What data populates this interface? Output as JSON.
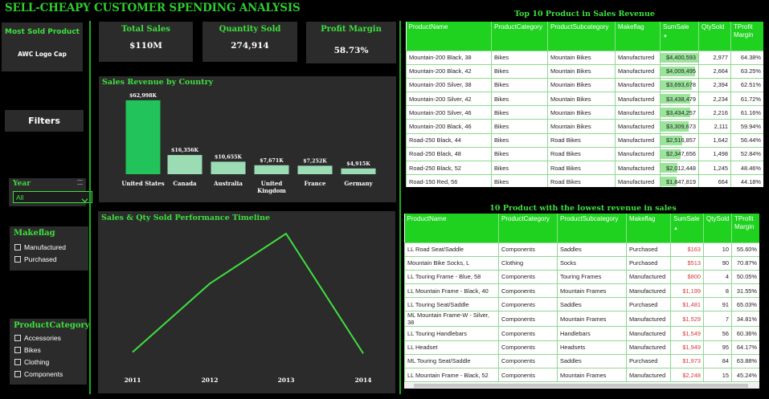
{
  "title": "SELL-CHEAPY CUSTOMER SPENDING ANALYSIS",
  "most_sold": {
    "label": "Most Sold Product",
    "value": "AWC Logo Cap"
  },
  "filters_label": "Filters",
  "kpis": [
    {
      "label": "Total Sales",
      "value": "$110M"
    },
    {
      "label": "Quantity Sold",
      "value": "274,914"
    },
    {
      "label": "Profit Margin",
      "value": "58.73%"
    }
  ],
  "year_slicer": {
    "title": "Year",
    "selected": "All"
  },
  "makeflag_slicer": {
    "title": "Makeflag",
    "options": [
      "Manufactured",
      "Purchased"
    ]
  },
  "category_slicer": {
    "title": "ProductCategory",
    "options": [
      "Accessories",
      "Bikes",
      "Clothing",
      "Components"
    ]
  },
  "chart_data": [
    {
      "type": "bar",
      "title": "Sales Revenue by Country",
      "categories": [
        "United States",
        "Canada",
        "Australia",
        "United Kingdom",
        "France",
        "Germany"
      ],
      "category_lines": [
        [
          "United States"
        ],
        [
          "Canada"
        ],
        [
          "Australia"
        ],
        [
          "United",
          "Kingdom"
        ],
        [
          "France"
        ],
        [
          "Germany"
        ]
      ],
      "values": [
        62998,
        16356,
        10655,
        7671,
        7252,
        4915
      ],
      "data_labels": [
        "$62,998K",
        "$16,356K",
        "$10,655K",
        "$7,671K",
        "$7,252K",
        "$4,915K"
      ],
      "colors": [
        "#22c35a",
        "#9bdcb5",
        "#9bdcb5",
        "#9bdcb5",
        "#9bdcb5",
        "#9bdcb5"
      ],
      "ylim": [
        0,
        65000
      ]
    },
    {
      "type": "line",
      "title": "Sales & Qty Sold Performance Timeline",
      "x": [
        "2011",
        "2012",
        "2013",
        "2014"
      ],
      "values": [
        0.1,
        0.62,
        1.0,
        0.09
      ],
      "color": "#3ee03e"
    }
  ],
  "top_table": {
    "title": "Top 10 Product in Sales Revenue",
    "headers": [
      "ProductName",
      "ProductCategory",
      "ProductSubcategory",
      "Makeflag",
      "SumSale",
      "QtySold",
      "TProfit Margin"
    ],
    "rows": [
      [
        "Mountain-200 Black, 38",
        "Bikes",
        "Mountain Bikes",
        "Manufactured",
        "$4,400,593",
        "2,977",
        "64.38%"
      ],
      [
        "Mountain-200 Black, 42",
        "Bikes",
        "Mountain Bikes",
        "Manufactured",
        "$4,009,495",
        "2,664",
        "63.25%"
      ],
      [
        "Mountain-200 Silver, 38",
        "Bikes",
        "Mountain Bikes",
        "Manufactured",
        "$3,693,678",
        "2,394",
        "62.51%"
      ],
      [
        "Mountain-200 Silver, 42",
        "Bikes",
        "Mountain Bikes",
        "Manufactured",
        "$3,438,479",
        "2,234",
        "61.72%"
      ],
      [
        "Mountain-200 Silver, 46",
        "Bikes",
        "Mountain Bikes",
        "Manufactured",
        "$3,434,257",
        "2,216",
        "61.16%"
      ],
      [
        "Mountain-200 Black, 46",
        "Bikes",
        "Mountain Bikes",
        "Manufactured",
        "$3,309,673",
        "2,111",
        "59.94%"
      ],
      [
        "Road-250 Black, 44",
        "Bikes",
        "Road Bikes",
        "Manufactured",
        "$2,516,857",
        "1,642",
        "56.44%"
      ],
      [
        "Road-250 Black, 48",
        "Bikes",
        "Road Bikes",
        "Manufactured",
        "$2,347,656",
        "1,498",
        "52.84%"
      ],
      [
        "Road-250 Black, 52",
        "Bikes",
        "Road Bikes",
        "Manufactured",
        "$2,012,448",
        "1,245",
        "48.46%"
      ],
      [
        "Road-150 Red, 56",
        "Bikes",
        "Road Bikes",
        "Manufactured",
        "$1,847,819",
        "664",
        "44.18%"
      ]
    ],
    "sum_values": [
      4400593,
      4009495,
      3693678,
      3438479,
      3434257,
      3309673,
      2516857,
      2347656,
      2012448,
      1847819
    ]
  },
  "bottom_table": {
    "title": "10 Product with the lowest revenue in sales",
    "headers": [
      "ProductName",
      "ProductCategory",
      "ProductSubcategory",
      "Makeflag",
      "SumSale",
      "QtySold",
      "TProfit Margin"
    ],
    "rows": [
      [
        "LL Road Seat/Saddle",
        "Components",
        "Saddles",
        "Purchased",
        "$163",
        "10",
        "55.60%"
      ],
      [
        "Mountain Bike Socks, L",
        "Clothing",
        "Socks",
        "Purchased",
        "$513",
        "90",
        "70.87%"
      ],
      [
        "LL Touring Frame - Blue, 58",
        "Components",
        "Touring Frames",
        "Manufactured",
        "$800",
        "4",
        "50.05%"
      ],
      [
        "LL Mountain Frame - Black, 40",
        "Components",
        "Mountain Frames",
        "Manufactured",
        "$1,199",
        "8",
        "31.55%"
      ],
      [
        "LL Touring Seat/Saddle",
        "Components",
        "Saddles",
        "Purchased",
        "$1,481",
        "91",
        "65.03%"
      ],
      [
        "ML Mountain Frame-W - Silver, 38",
        "Components",
        "Mountain Frames",
        "Manufactured",
        "$1,529",
        "7",
        "34.81%"
      ],
      [
        "LL Touring Handlebars",
        "Components",
        "Handlebars",
        "Manufactured",
        "$1,549",
        "56",
        "60.36%"
      ],
      [
        "LL Headset",
        "Components",
        "Headsets",
        "Manufactured",
        "$1,949",
        "95",
        "64.17%"
      ],
      [
        "ML Touring Seat/Saddle",
        "Components",
        "Saddles",
        "Purchased",
        "$1,973",
        "84",
        "63.88%"
      ],
      [
        "LL Mountain Frame - Black, 52",
        "Components",
        "Mountain Frames",
        "Manufactured",
        "$2,248",
        "15",
        "45.24%"
      ]
    ]
  }
}
